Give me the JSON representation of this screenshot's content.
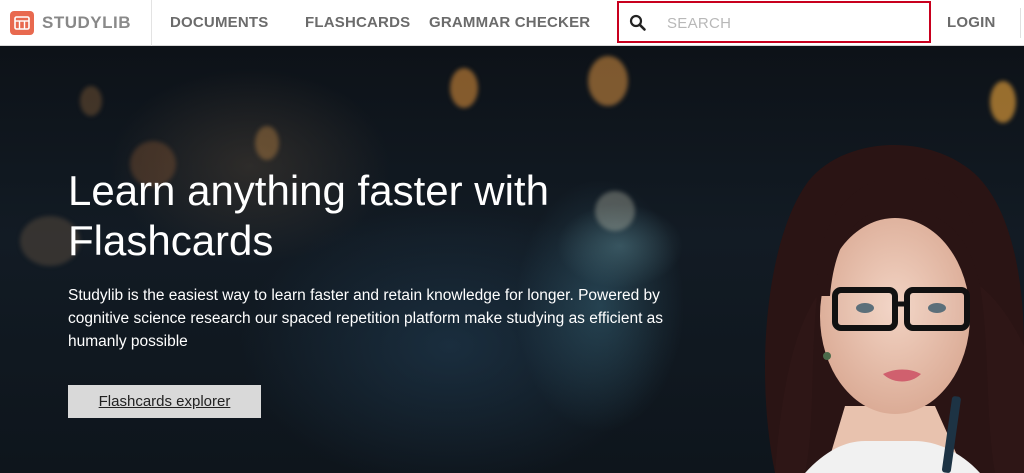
{
  "brand": {
    "name_hi": "STUDY",
    "name_lo": "LIB"
  },
  "nav": {
    "documents": "DOCUMENTS",
    "flashcards": "FLASHCARDS",
    "grammar": "GRAMMAR CHECKER",
    "login": "LOGIN"
  },
  "search": {
    "placeholder": "SEARCH",
    "value": ""
  },
  "hero": {
    "title": "Learn anything faster with Flashcards",
    "description": "Studylib is the easiest way to learn faster and retain knowledge for longer. Powered by cognitive science research our spaced repetition platform make studying as efficient as humanly possible",
    "button_label": "Flashcards explorer"
  },
  "colors": {
    "brand_accent": "#e8694f",
    "search_border": "#c8001e",
    "nav_text": "#6b6b6b"
  },
  "icons": [
    "studylib-logo-icon",
    "search-icon"
  ]
}
